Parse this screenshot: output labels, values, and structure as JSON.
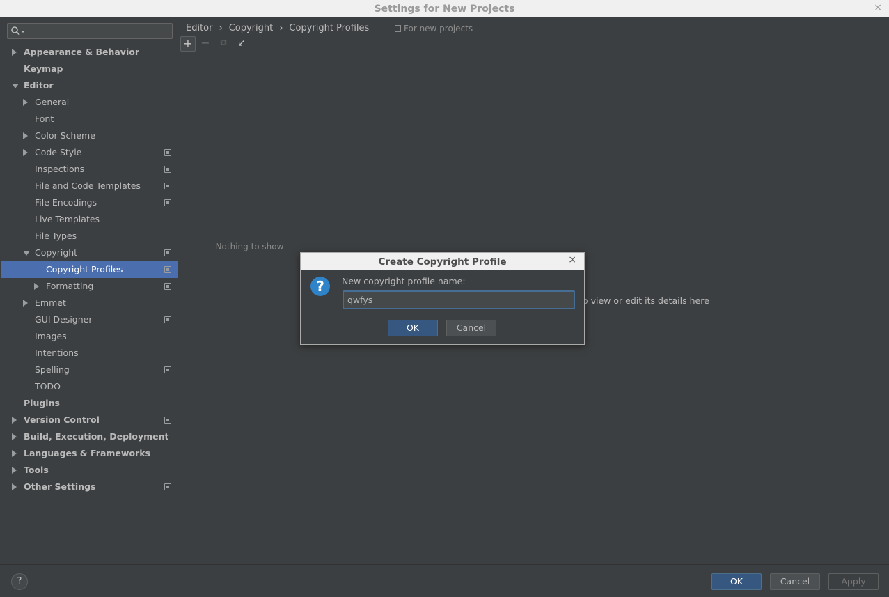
{
  "window": {
    "title": "Settings for New Projects",
    "close_glyph": "×"
  },
  "search": {
    "value": "",
    "placeholder": ""
  },
  "tree": [
    {
      "label": "Appearance & Behavior",
      "level": 0,
      "bold": true,
      "arrow": "right",
      "project_icon": false
    },
    {
      "label": "Keymap",
      "level": 0,
      "bold": true,
      "arrow": "none",
      "project_icon": false
    },
    {
      "label": "Editor",
      "level": 0,
      "bold": true,
      "arrow": "down",
      "project_icon": false
    },
    {
      "label": "General",
      "level": 1,
      "bold": false,
      "arrow": "right",
      "project_icon": false
    },
    {
      "label": "Font",
      "level": 1,
      "bold": false,
      "arrow": "none",
      "project_icon": false
    },
    {
      "label": "Color Scheme",
      "level": 1,
      "bold": false,
      "arrow": "right",
      "project_icon": false
    },
    {
      "label": "Code Style",
      "level": 1,
      "bold": false,
      "arrow": "right",
      "project_icon": true
    },
    {
      "label": "Inspections",
      "level": 1,
      "bold": false,
      "arrow": "none",
      "project_icon": true
    },
    {
      "label": "File and Code Templates",
      "level": 1,
      "bold": false,
      "arrow": "none",
      "project_icon": true
    },
    {
      "label": "File Encodings",
      "level": 1,
      "bold": false,
      "arrow": "none",
      "project_icon": true
    },
    {
      "label": "Live Templates",
      "level": 1,
      "bold": false,
      "arrow": "none",
      "project_icon": false
    },
    {
      "label": "File Types",
      "level": 1,
      "bold": false,
      "arrow": "none",
      "project_icon": false
    },
    {
      "label": "Copyright",
      "level": 1,
      "bold": false,
      "arrow": "down",
      "project_icon": true
    },
    {
      "label": "Copyright Profiles",
      "level": 2,
      "bold": false,
      "arrow": "none",
      "project_icon": true,
      "selected": true
    },
    {
      "label": "Formatting",
      "level": 2,
      "bold": false,
      "arrow": "right",
      "project_icon": true
    },
    {
      "label": "Emmet",
      "level": 1,
      "bold": false,
      "arrow": "right",
      "project_icon": false
    },
    {
      "label": "GUI Designer",
      "level": 1,
      "bold": false,
      "arrow": "none",
      "project_icon": true
    },
    {
      "label": "Images",
      "level": 1,
      "bold": false,
      "arrow": "none",
      "project_icon": false
    },
    {
      "label": "Intentions",
      "level": 1,
      "bold": false,
      "arrow": "none",
      "project_icon": false
    },
    {
      "label": "Spelling",
      "level": 1,
      "bold": false,
      "arrow": "none",
      "project_icon": true
    },
    {
      "label": "TODO",
      "level": 1,
      "bold": false,
      "arrow": "none",
      "project_icon": false
    },
    {
      "label": "Plugins",
      "level": 0,
      "bold": true,
      "arrow": "none",
      "project_icon": false
    },
    {
      "label": "Version Control",
      "level": 0,
      "bold": true,
      "arrow": "right",
      "project_icon": true
    },
    {
      "label": "Build, Execution, Deployment",
      "level": 0,
      "bold": true,
      "arrow": "right",
      "project_icon": false
    },
    {
      "label": "Languages & Frameworks",
      "level": 0,
      "bold": true,
      "arrow": "right",
      "project_icon": false
    },
    {
      "label": "Tools",
      "level": 0,
      "bold": true,
      "arrow": "right",
      "project_icon": false
    },
    {
      "label": "Other Settings",
      "level": 0,
      "bold": true,
      "arrow": "right",
      "project_icon": true
    }
  ],
  "breadcrumb": {
    "items": [
      "Editor",
      "Copyright",
      "Copyright Profiles"
    ],
    "separator": "›",
    "scope_label": "For new projects"
  },
  "toolbar": {
    "add_glyph": "+",
    "remove_glyph": "−",
    "copy_glyph": "⧉",
    "import_glyph": "↙"
  },
  "list": {
    "empty_text": "Nothing to show"
  },
  "details": {
    "hint_text": "o view or edit its details here"
  },
  "footer": {
    "help_glyph": "?",
    "ok_label": "OK",
    "cancel_label": "Cancel",
    "apply_label": "Apply"
  },
  "dialog": {
    "title": "Create Copyright Profile",
    "close_glyph": "×",
    "icon_glyph": "?",
    "prompt": "New copyright profile name:",
    "input_value": "qwfys",
    "ok_label": "OK",
    "cancel_label": "Cancel"
  },
  "colors": {
    "background": "#3c3f41",
    "selection": "#4b6eaf",
    "primary_button": "#365880",
    "question_icon": "#2f83c9"
  }
}
